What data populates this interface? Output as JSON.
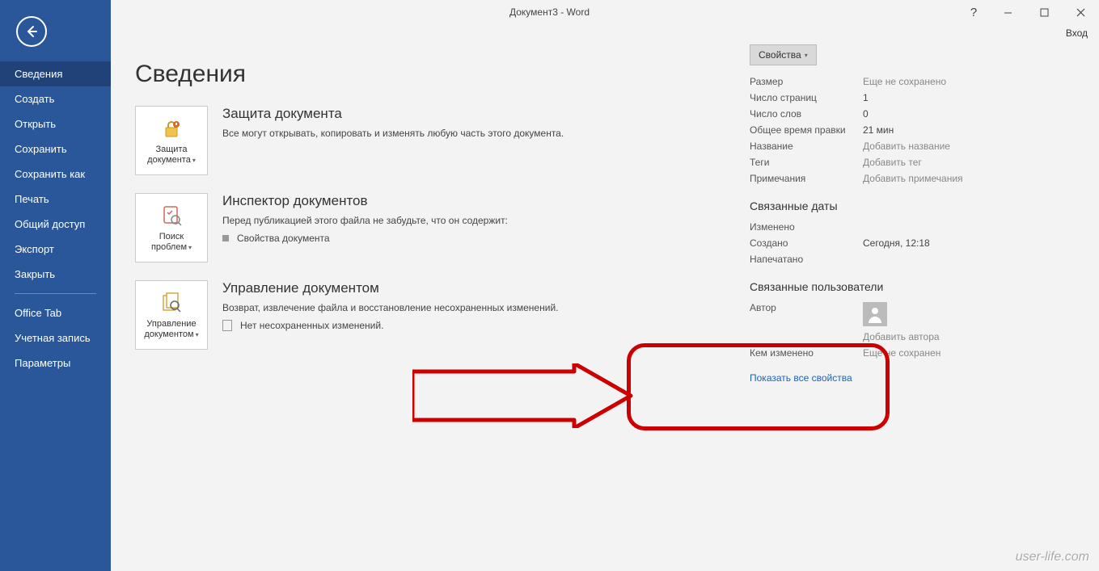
{
  "window": {
    "title": "Документ3 - Word",
    "login": "Вход"
  },
  "sidebar": {
    "items": [
      "Сведения",
      "Создать",
      "Открыть",
      "Сохранить",
      "Сохранить как",
      "Печать",
      "Общий доступ",
      "Экспорт",
      "Закрыть"
    ],
    "items2": [
      "Office Tab",
      "Учетная запись",
      "Параметры"
    ],
    "active": 0
  },
  "page": {
    "title": "Сведения"
  },
  "sections": {
    "protect": {
      "card": "Защита документа",
      "title": "Защита документа",
      "text": "Все могут открывать, копировать и изменять любую часть этого документа."
    },
    "inspect": {
      "card": "Поиск проблем",
      "title": "Инспектор документов",
      "text": "Перед публикацией этого файла не забудьте, что он содержит:",
      "bullet": "Свойства документа"
    },
    "manage": {
      "card": "Управление документом",
      "title": "Управление документом",
      "text": "Возврат, извлечение файла и восстановление несохраненных изменений.",
      "bullet": "Нет несохраненных изменений."
    }
  },
  "props": {
    "button": "Свойства",
    "rows": [
      {
        "k": "Размер",
        "v": "Еще не сохранено",
        "ph": true
      },
      {
        "k": "Число страниц",
        "v": "1"
      },
      {
        "k": "Число слов",
        "v": "0"
      },
      {
        "k": "Общее время правки",
        "v": "21 мин"
      },
      {
        "k": "Название",
        "v": "Добавить название",
        "ph": true
      },
      {
        "k": "Теги",
        "v": "Добавить тег",
        "ph": true
      },
      {
        "k": "Примечания",
        "v": "Добавить примечания",
        "ph": true
      }
    ],
    "dates": {
      "title": "Связанные даты",
      "rows": [
        {
          "k": "Изменено",
          "v": ""
        },
        {
          "k": "Создано",
          "v": "Сегодня, 12:18"
        },
        {
          "k": "Напечатано",
          "v": ""
        }
      ]
    },
    "people": {
      "title": "Связанные пользователи",
      "author_k": "Автор",
      "add_author": "Добавить автора",
      "modified_k": "Кем изменено",
      "modified_v": "Еще не сохранен"
    },
    "show_all": "Показать все свойства"
  },
  "watermark": "user-life.com"
}
